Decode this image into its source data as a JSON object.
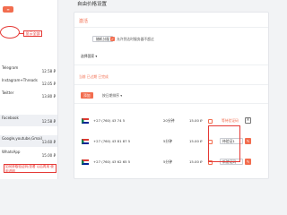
{
  "sidebar": {
    "top_button": "≡",
    "annotation_label": "显示全部",
    "items": [
      {
        "name": "Telegram",
        "price": "12.58 ₽"
      },
      {
        "name": "Instagram+Threads",
        "price": "12.05 ₽"
      },
      {
        "name": "Twitter",
        "price": "13.80 ₽"
      },
      {
        "name": "Facebook",
        "price": "12.58 ₽"
      },
      {
        "name": "Google,youtube,Gmail",
        "price": "13.60 ₽"
      },
      {
        "name": "WhatsApp",
        "price": "15.00 ₽"
      }
    ],
    "bottom_note": "如何获取验证码/查看 以后再用 使用说明"
  },
  "main": {
    "page_title": "自由价格设置",
    "panel_title": "激活",
    "chip_label": "随机分配",
    "checkbox_label": "允许到达时服务器不超过",
    "select_label": "选择国家 ▾",
    "tabs_label": "当前 已过期 已完成",
    "add_button": "添加",
    "sort_label": "按日期排序 ▾",
    "rows": [
      {
        "number": "+27 (760) 43 74 5",
        "time": "20分钟",
        "price": "15.00 ₽",
        "status": "等待验证码",
        "flag": "south-africa"
      },
      {
        "number": "+27 (760) 43 81 87 5",
        "time": "5分钟",
        "price": "15.00 ₽",
        "status": "待验证1",
        "flag": "south-africa"
      },
      {
        "number": "+27 (760) 43 62 65 5",
        "time": "5分钟",
        "price": "15.00 ₽",
        "status": "新验证码",
        "flag": "south-africa"
      }
    ]
  },
  "colors": {
    "accent": "#f26d4f",
    "annotation_red": "#e53935"
  }
}
